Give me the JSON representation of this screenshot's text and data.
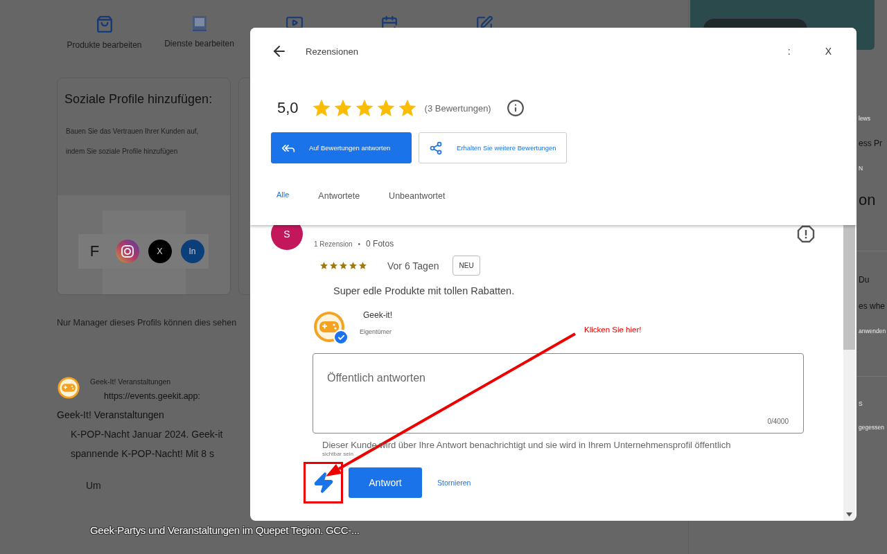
{
  "page": {
    "actions": [
      {
        "kind": "bag",
        "label": "Produkte bearbeiten"
      },
      {
        "kind": "book",
        "label": "Dienste bearbeiten"
      },
      {
        "kind": "media"
      },
      {
        "kind": "add"
      },
      {
        "kind": "edit"
      }
    ],
    "social_card": {
      "title": "Soziale Profile hinzufügen:",
      "lines": [
        "Bauen Sie das Vertrauen Ihrer Kunden auf,",
        "indem Sie soziale Profile hinzufügen"
      ],
      "networks": [
        {
          "kind": "facebook",
          "label": "F"
        },
        {
          "kind": "instagram"
        },
        {
          "kind": "x",
          "label": "X"
        },
        {
          "kind": "linkedin",
          "label": "In"
        }
      ]
    },
    "manager_note": "Nur Manager dieses Profils können dies sehen",
    "post": {
      "author": "Geek-It! Veranstaltungen",
      "link": "https://events.geekit.app:",
      "title": "Geek-It! Veranstaltungen",
      "lines": [
        "K-POP-Nacht Januar 2024. Geek-it",
        "spannende K-POP-Nacht! Mit 8 s"
      ],
      "more": "Um"
    },
    "side_fragments": [
      {
        "kind": "small",
        "text": "lews"
      },
      {
        "kind": "text",
        "text": "ess Pr"
      },
      {
        "kind": "small",
        "text": "N"
      },
      {
        "kind": "large",
        "text": "on"
      },
      {
        "kind": "divider"
      },
      {
        "kind": "text",
        "text": "Du"
      },
      {
        "kind": "text",
        "text": "es whe"
      },
      {
        "kind": "small",
        "text": "anwenden"
      },
      {
        "kind": "divider"
      },
      {
        "kind": "small",
        "text": "S"
      },
      {
        "kind": "small",
        "text": "gegessen"
      }
    ]
  },
  "dialog": {
    "title": "Rezensionen",
    "menu": ":",
    "close": "X",
    "rating": "5,0",
    "stars": 5,
    "count": "(3 Bewertungen)",
    "buttons": [
      {
        "kind": "primary",
        "label": "Auf Bewertungen antworten"
      },
      {
        "kind": "outline",
        "label": "Erhalten Sie weitere Bewertungen"
      }
    ],
    "tabs": [
      {
        "label": "Alle",
        "selected": true
      },
      {
        "label": "Antwortete",
        "selected": false
      },
      {
        "label": "Unbeantwortet",
        "selected": false
      }
    ],
    "review": {
      "initial": "S",
      "reviews": "1 Rezension",
      "separator": "•",
      "photos": "0 Fotos",
      "stars": 5,
      "age": "Vor 6 Tagen",
      "badge": "NEU",
      "text": "Super edle Produkte mit tollen Rabatten.",
      "owner": {
        "name": "Geek-it!",
        "role": "Eigentümer",
        "verified": true
      },
      "reply": {
        "placeholder": "Öffentlich antworten",
        "counter": "0/4000",
        "note": "Dieser Kunde wird über Ihre Antwort benachrichtigt und sie wird in Ihrem Unternehmensprofil öffentlich",
        "note_end": "sichtbar sein",
        "submit": "Antwort",
        "cancel": "Stornieren"
      }
    }
  },
  "annotation": {
    "text": "Klicken Sie hier!"
  },
  "caption": "Geek-Partys und Veranstaltungen im Quepet Tegion. GCC-..."
}
